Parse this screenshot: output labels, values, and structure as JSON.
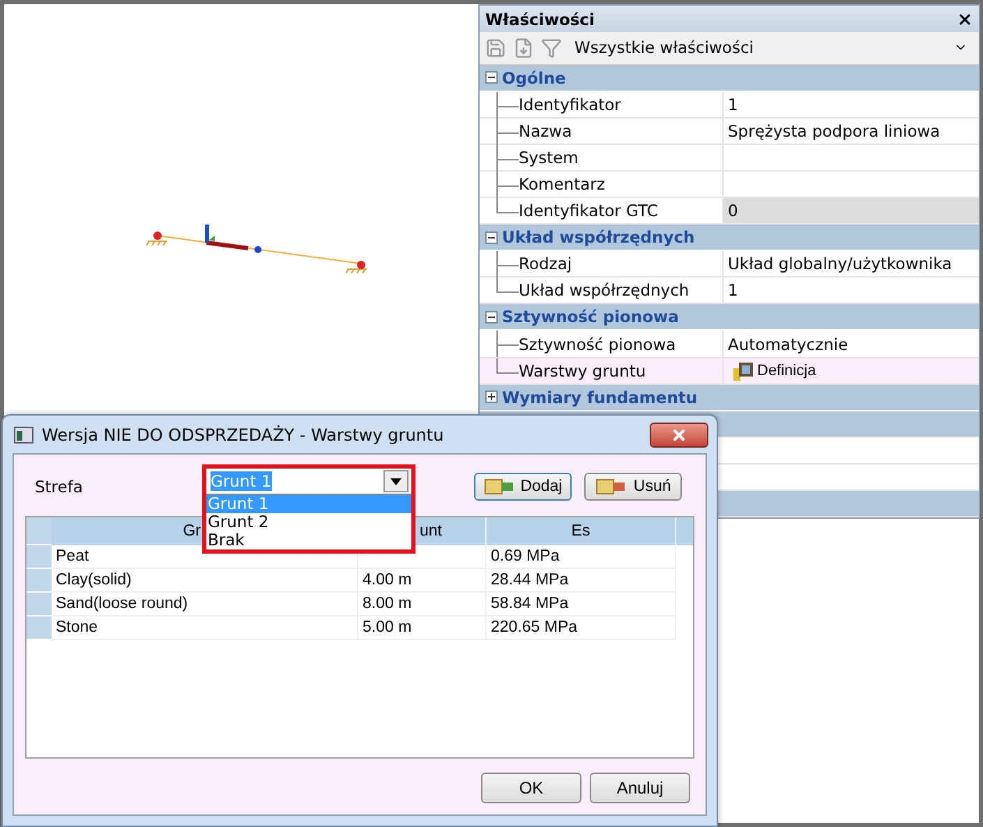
{
  "properties": {
    "title": "Właściwości",
    "filter": "Wszystkie właściwości",
    "groups": [
      {
        "title": "Ogólne",
        "expanded": true,
        "rows": [
          {
            "label": "Identyfikator",
            "value": "1",
            "kind": "text",
            "readonly": false,
            "selected": false
          },
          {
            "label": "Nazwa",
            "value": "Sprężysta podpora liniowa",
            "kind": "text",
            "readonly": false,
            "selected": false
          },
          {
            "label": "System",
            "kind": "text",
            "readonly": false,
            "selected": false
          },
          {
            "label": "Komentarz",
            "kind": "text",
            "readonly": false,
            "selected": false
          },
          {
            "label": "Identyfikator GTC",
            "value": "0",
            "kind": "text",
            "readonly": true,
            "selected": false
          }
        ]
      },
      {
        "title": "Układ współrzędnych",
        "expanded": true,
        "rows": [
          {
            "label": "Rodzaj",
            "value": "Układ globalny/użytkownika",
            "kind": "text",
            "readonly": false,
            "selected": false
          },
          {
            "label": "Układ współrzędnych",
            "value": "1",
            "kind": "text",
            "readonly": false,
            "selected": false
          }
        ]
      },
      {
        "title": "Sztywność pionowa",
        "expanded": true,
        "rows": [
          {
            "label": "Sztywność pionowa",
            "value": "Automatycznie",
            "kind": "text",
            "readonly": false,
            "selected": false
          },
          {
            "label": "Warstwy gruntu",
            "value": "Definicja",
            "kind": "definition",
            "readonly": false,
            "selected": true
          }
        ]
      },
      {
        "title": "Wymiary fundamentu",
        "expanded": false
      }
    ]
  },
  "dialog": {
    "title": "Wersja NIE DO ODSPRZEDAŻY - Warstwy gruntu",
    "zone_label": "Strefa",
    "zone_value": "Grunt 1",
    "zone_options": [
      {
        "label": "Grunt 1",
        "selected": true
      },
      {
        "label": "Grunt 2",
        "selected": false
      },
      {
        "label": "Brak",
        "selected": false
      }
    ],
    "add_button": "Dodaj",
    "remove_button": "Usuń",
    "columns": [
      "Gr",
      "unt",
      "Es"
    ],
    "rows": [
      {
        "column_1": "Peat",
        "column_3": "0.69 MPa"
      },
      {
        "column_1": "Clay(solid)",
        "column_2": "4.00 m",
        "column_3": "28.44 MPa"
      },
      {
        "column_1": "Sand(loose round)",
        "column_2": "8.00 m",
        "column_3": "58.84 MPa"
      },
      {
        "column_1": "Stone",
        "column_2": "5.00 m",
        "column_3": "220.65 MPa"
      }
    ],
    "ok_button": "OK",
    "cancel_button": "Anuluj"
  }
}
